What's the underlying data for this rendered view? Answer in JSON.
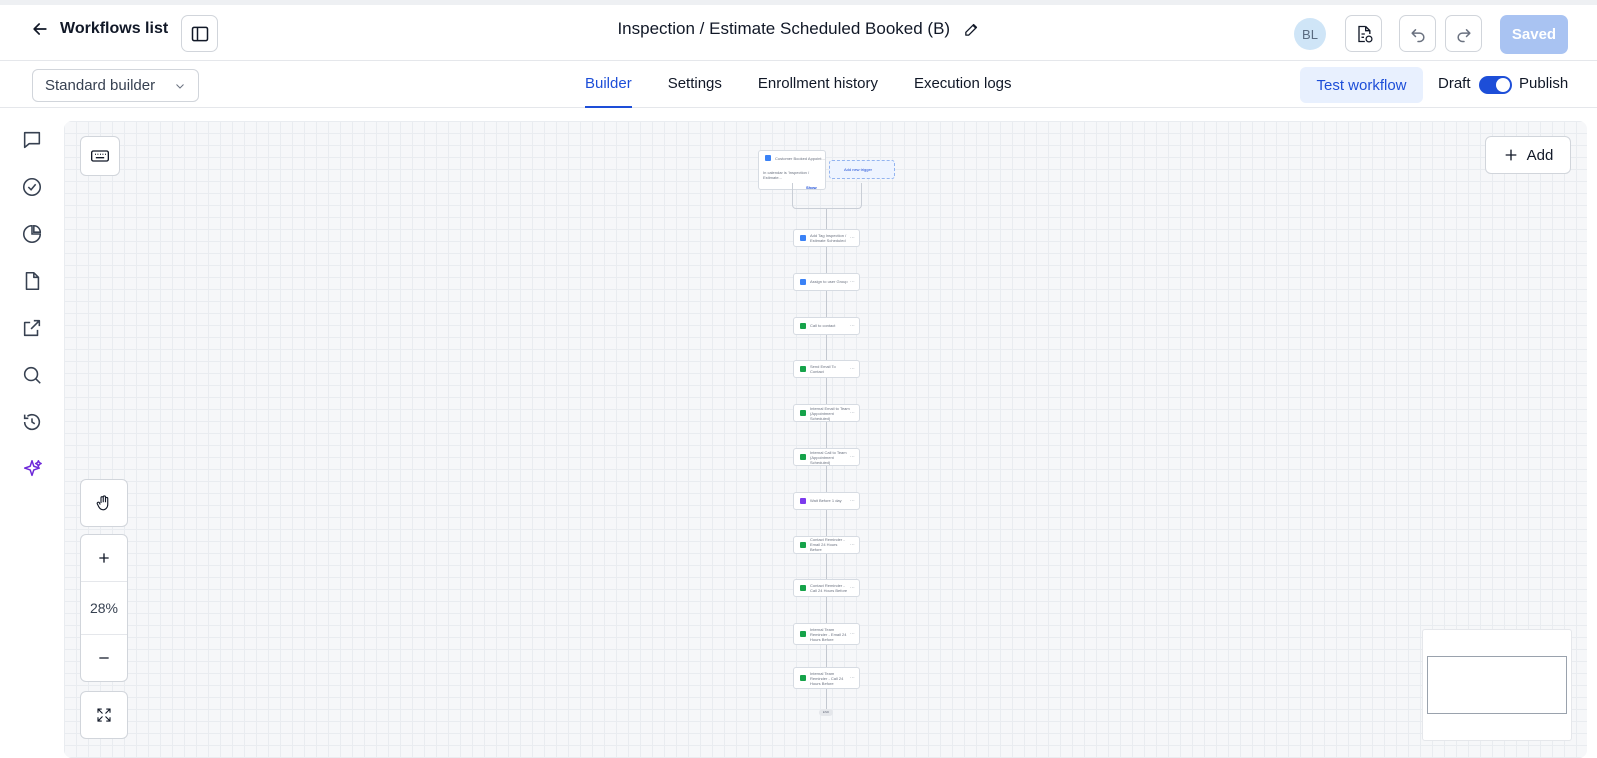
{
  "header": {
    "back_label": "Workflows list",
    "workflow_title": "Inspection / Estimate Scheduled Booked (B)",
    "avatar_initials": "BL",
    "saved_label": "Saved"
  },
  "subheader": {
    "builder_mode": "Standard builder",
    "tabs": [
      {
        "label": "Builder",
        "active": true
      },
      {
        "label": "Settings",
        "active": false
      },
      {
        "label": "Enrollment history",
        "active": false
      },
      {
        "label": "Execution logs",
        "active": false
      }
    ],
    "test_label": "Test workflow",
    "draft_label": "Draft",
    "publish_label": "Publish",
    "publish_toggle_on": true
  },
  "left_rail": {
    "icons": [
      "chat-icon",
      "check-circle-icon",
      "pie-chart-icon",
      "document-icon",
      "external-link-icon",
      "search-icon",
      "history-icon",
      "sparkles-icon"
    ]
  },
  "canvas": {
    "add_label": "Add",
    "zoom_level": "28%",
    "trigger": {
      "name": "Customer Booked Appoint...",
      "condition": "In calendar is 'Inspection / Estimate...",
      "action_label": "Show",
      "add_trigger_label": "Add new trigger"
    },
    "steps": [
      {
        "label": "Add Tag Inspection / Estimate Scheduled",
        "color": "#3b82f6"
      },
      {
        "label": "Assign to user Group",
        "color": "#3b82f6"
      },
      {
        "label": "Call to contact",
        "color": "#16a34a"
      },
      {
        "label": "Send Email To Contact",
        "color": "#16a34a"
      },
      {
        "label": "Internal Email to Team (Appointment Scheduled)",
        "color": "#16a34a"
      },
      {
        "label": "Internal Call to Team (Appointment Scheduled)",
        "color": "#16a34a"
      },
      {
        "label": "Wait Before 1 day",
        "color": "#7c3aed"
      },
      {
        "label": "Contact Reminder - Email 24 Hours Before",
        "color": "#16a34a"
      },
      {
        "label": "Contact Reminder - Call 24 Hours Before",
        "color": "#16a34a"
      },
      {
        "label": "Internal Team Reminder - Email 24 Hours Before",
        "color": "#16a34a"
      },
      {
        "label": "Internal Team Reminder - Call 24 Hours Before",
        "color": "#16a34a"
      }
    ],
    "end_label": "END"
  }
}
